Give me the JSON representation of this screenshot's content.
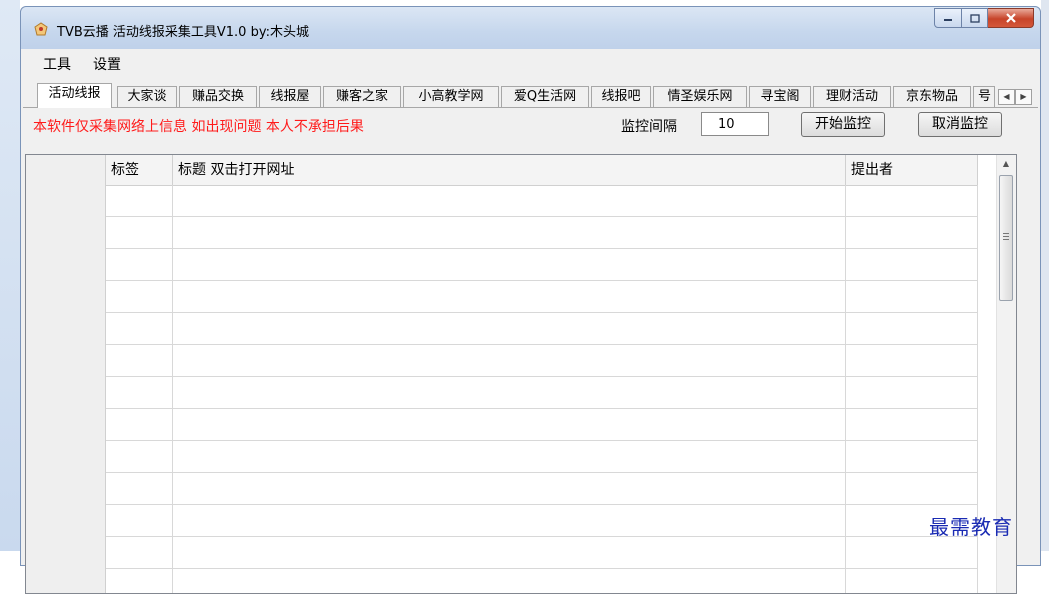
{
  "window": {
    "title": "TVB云播 活动线报采集工具V1.0  by:木头城"
  },
  "menu": {
    "items": [
      "工具",
      "设置"
    ]
  },
  "tabs": {
    "items": [
      "活动线报",
      "大家谈",
      "赚品交换",
      "线报屋",
      "赚客之家",
      "小高教学网",
      "爱Q生活网",
      "线报吧",
      "情圣娱乐网",
      "寻宝阁",
      "理财活动",
      "京东物品",
      "号"
    ],
    "active_index": 0
  },
  "toolbar": {
    "disclaimer": "本软件仅采集网络上信息 如出现问题 本人不承担后果",
    "interval_label": "监控间隔",
    "interval_value": "10",
    "start_label": "开始监控",
    "cancel_label": "取消监控",
    "disclaimer_color": "#ff1a1a"
  },
  "grid": {
    "columns": [
      "",
      "标签",
      "标题 双击打开网址",
      "提出者"
    ],
    "rows": []
  },
  "watermark": "最需教育"
}
